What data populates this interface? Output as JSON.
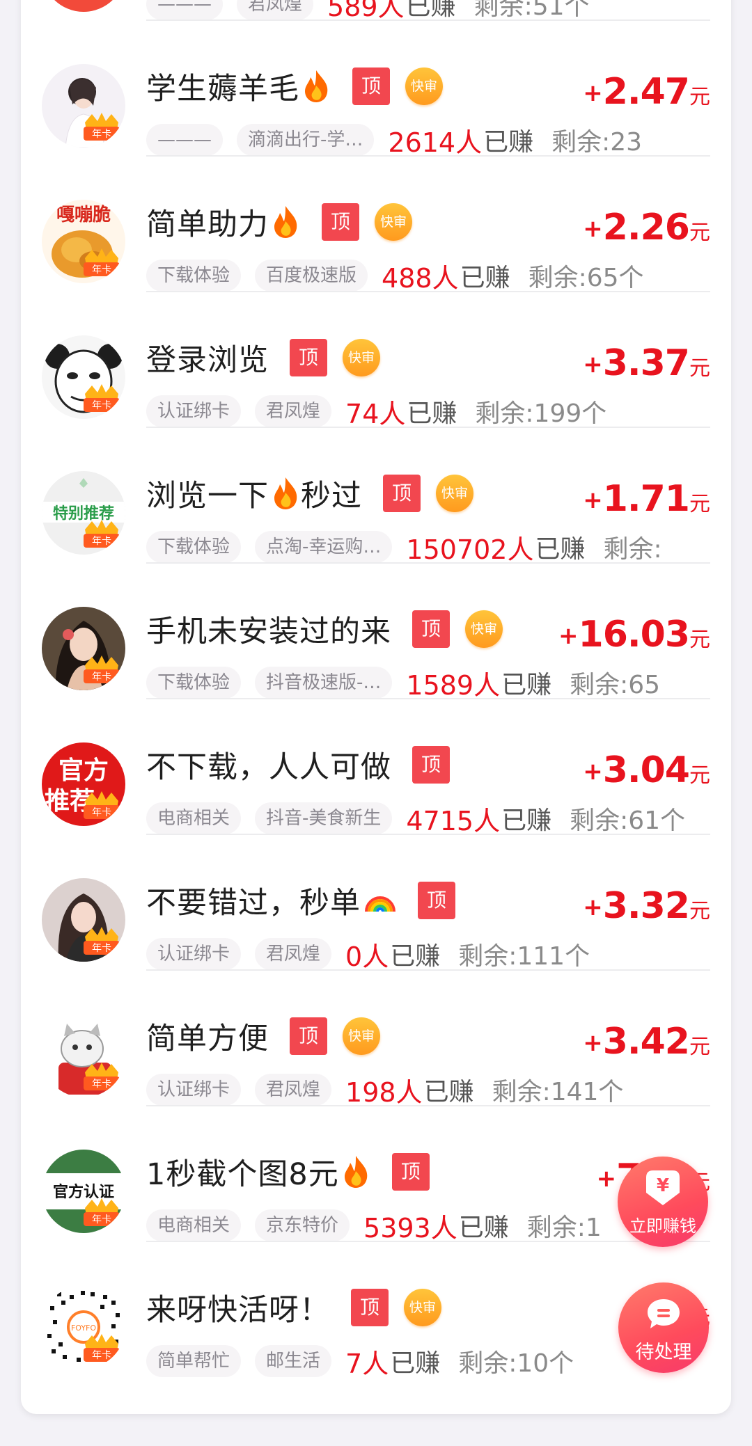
{
  "top_partial": {
    "tag1": "———",
    "tag2": "君凤煌",
    "count": "589人",
    "earned": "已赚",
    "remain": "剩余:51个"
  },
  "badges": {
    "ding": "顶",
    "kuai": "快审",
    "nianka": "年卡",
    "yuan": "元",
    "plus": "+"
  },
  "tasks": [
    {
      "title": "学生薅羊毛",
      "tags": [
        "———",
        "滴滴出行-学…"
      ],
      "price": "2.47",
      "count": "2614人",
      "earned": "已赚",
      "remain": "剩余:23"
    },
    {
      "title": "简单助力",
      "tags": [
        "下载体验",
        "百度极速版"
      ],
      "price": "2.26",
      "count": "488人",
      "earned": "已赚",
      "remain": "剩余:65个"
    },
    {
      "title": "登录浏览",
      "tags": [
        "认证绑卡",
        "君凤煌"
      ],
      "price": "3.37",
      "count": "74人",
      "earned": "已赚",
      "remain": "剩余:199个"
    },
    {
      "title": "浏览一下",
      "title_suffix": "秒过",
      "tags": [
        "下载体验",
        "点淘-幸运购…"
      ],
      "price": "1.71",
      "count": "150702人",
      "earned": "已赚",
      "remain": "剩余:"
    },
    {
      "title": "手机未安装过的来",
      "tags": [
        "下载体验",
        "抖音极速版-…"
      ],
      "price": "16.03",
      "count": "1589人",
      "earned": "已赚",
      "remain": "剩余:65"
    },
    {
      "title": "不下载，人人可做",
      "tags": [
        "电商相关",
        "抖音-美食新生"
      ],
      "price": "3.04",
      "count": "4715人",
      "earned": "已赚",
      "remain": "剩余:61个"
    },
    {
      "title": "不要错过，秒单",
      "tags": [
        "认证绑卡",
        "君凤煌"
      ],
      "price": "3.32",
      "count": "0人",
      "earned": "已赚",
      "remain": "剩余:111个"
    },
    {
      "title": "简单方便",
      "tags": [
        "认证绑卡",
        "君凤煌"
      ],
      "price": "3.42",
      "count": "198人",
      "earned": "已赚",
      "remain": "剩余:141个"
    },
    {
      "title": "1秒截个图8元",
      "tags": [
        "电商相关",
        "京东特价"
      ],
      "price": "7.…",
      "count": "5393人",
      "earned": "已赚",
      "remain": "剩余:1"
    },
    {
      "title": "来呀快活呀！",
      "tags": [
        "简单帮忙",
        "邮生活"
      ],
      "price": "…",
      "count": "7人",
      "earned": "已赚",
      "remain": "剩余:10个"
    }
  ],
  "avatar_text": {
    "a2": "嘎嘣脆",
    "a4": "特别推荐",
    "a6_line1": "官方",
    "a6_line2": "推荐",
    "a9": "官方认证",
    "a10": "FOYFO"
  },
  "fabs": {
    "earn_label": "立即赚钱",
    "earn_icon": "¥",
    "pending_label": "待处理"
  },
  "colors": {
    "accent_red": "#e8131e",
    "ding_red": "#f2474f",
    "kuai_orange": "#ff9a1e",
    "fab_red": "#ff4b5c"
  }
}
